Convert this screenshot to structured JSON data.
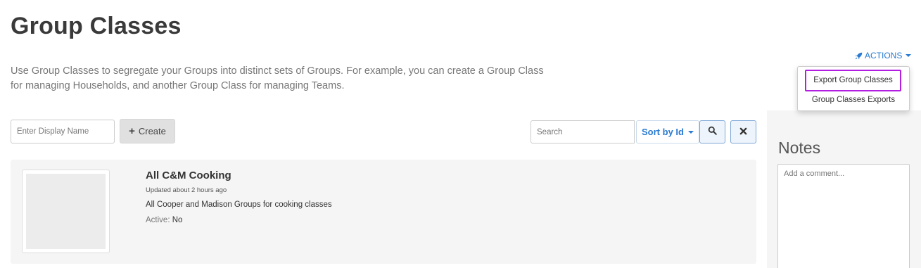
{
  "page": {
    "title": "Group Classes",
    "description": "Use Group Classes to segregate your Groups into distinct sets of Groups. For example, you can create a Group Class for managing Households, and another Group Class for managing Teams."
  },
  "actions": {
    "label": "ACTIONS",
    "icon": "rocket-icon",
    "menu": [
      {
        "label": "Export Group Classes",
        "highlighted": true
      },
      {
        "label": "Group Classes Exports",
        "highlighted": false
      }
    ]
  },
  "toolbar": {
    "name_placeholder": "Enter Display Name",
    "create_label": "Create",
    "search_placeholder": "Search",
    "sort_label": "Sort by Id"
  },
  "notes": {
    "title": "Notes",
    "placeholder": "Add a comment..."
  },
  "group_classes": [
    {
      "name": "All C&M Cooking",
      "updated": "Updated about 2 hours ago",
      "description": "All Cooper and Madison Groups for cooking classes",
      "active_label": "Active:",
      "active_value": "No"
    }
  ],
  "colors": {
    "link_blue": "#2a7ad2",
    "highlight_border": "#b21fe0",
    "card_background": "#f5f5f5"
  }
}
